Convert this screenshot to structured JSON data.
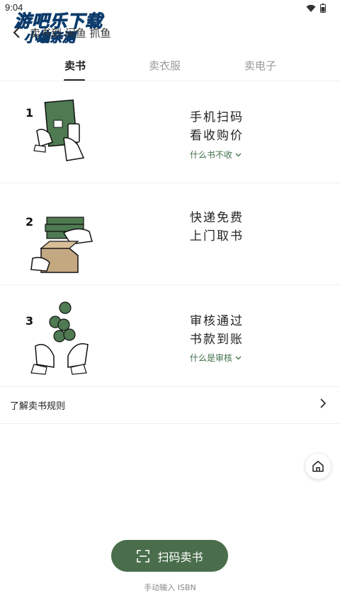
{
  "status_bar": {
    "time": "9:04"
  },
  "watermark": {
    "line1": "游吧乐下载",
    "line2": "小编亲测"
  },
  "nav": {
    "title": "卖书到 闲鱼 抓鱼"
  },
  "tabs": [
    {
      "label": "卖书",
      "active": true
    },
    {
      "label": "卖衣服",
      "active": false
    },
    {
      "label": "卖电子",
      "active": false
    }
  ],
  "steps": [
    {
      "number": "1",
      "line1": "手机扫码",
      "line2": "看收购价",
      "link": "什么书不收"
    },
    {
      "number": "2",
      "line1": "快递免费",
      "line2": "上门取书",
      "link": ""
    },
    {
      "number": "3",
      "line1": "审核通过",
      "line2": "书款到账",
      "link": "什么是审核"
    }
  ],
  "rules": {
    "label": "了解卖书规则"
  },
  "actions": {
    "scan_label": "扫码卖书",
    "manual_label": "手动输入 ISBN"
  },
  "colors": {
    "accent": "#4a6e4c",
    "link": "#3f6f48",
    "illus_green": "#4f7a52"
  }
}
